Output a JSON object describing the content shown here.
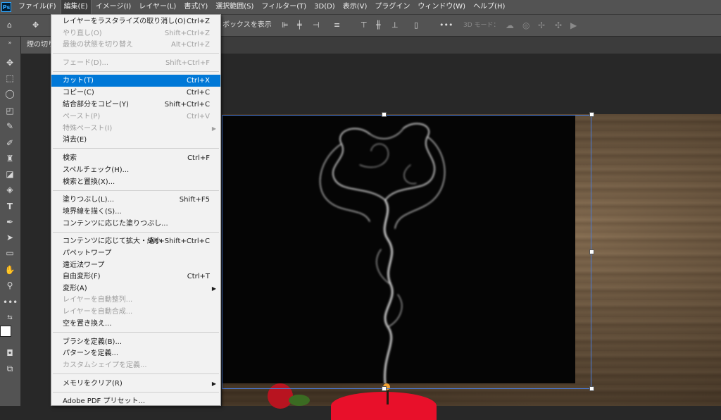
{
  "app": {
    "logo": "Ps"
  },
  "menubar": [
    "ファイル(F)",
    "編集(E)",
    "イメージ(I)",
    "レイヤー(L)",
    "書式(Y)",
    "選択範囲(S)",
    "フィルター(T)",
    "3D(D)",
    "表示(V)",
    "プラグイン",
    "ウィンドウ(W)",
    "ヘルプ(H)"
  ],
  "options": {
    "show_box": "ボックスを表示",
    "mode_3d": "3D モード：",
    "more": "•••"
  },
  "document": {
    "tab_title": "煙の切り"
  },
  "edit_menu": [
    {
      "label": "レイヤーをラスタライズの取り消し(O)",
      "shortcut": "Ctrl+Z",
      "disabled": false
    },
    {
      "label": "やり直し(O)",
      "shortcut": "Shift+Ctrl+Z",
      "disabled": true
    },
    {
      "label": "最後の状態を切り替え",
      "shortcut": "Alt+Ctrl+Z",
      "disabled": true
    },
    {
      "label": "フェード(D)...",
      "shortcut": "Shift+Ctrl+F",
      "disabled": true
    },
    {
      "label": "カット(T)",
      "shortcut": "Ctrl+X",
      "highlight": true
    },
    {
      "label": "コピー(C)",
      "shortcut": "Ctrl+C"
    },
    {
      "label": "結合部分をコピー(Y)",
      "shortcut": "Shift+Ctrl+C"
    },
    {
      "label": "ペースト(P)",
      "shortcut": "Ctrl+V",
      "disabled": true
    },
    {
      "label": "特殊ペースト(I)",
      "shortcut": "",
      "disabled": true,
      "submenu": true
    },
    {
      "label": "消去(E)",
      "shortcut": ""
    },
    {
      "label": "検索",
      "shortcut": "Ctrl+F"
    },
    {
      "label": "スペルチェック(H)...",
      "shortcut": ""
    },
    {
      "label": "検索と置換(X)...",
      "shortcut": ""
    },
    {
      "label": "塗りつぶし(L)...",
      "shortcut": "Shift+F5"
    },
    {
      "label": "境界線を描く(S)...",
      "shortcut": ""
    },
    {
      "label": "コンテンツに応じた塗りつぶし...",
      "shortcut": ""
    },
    {
      "label": "コンテンツに応じて拡大・縮小",
      "shortcut": "Alt+Shift+Ctrl+C"
    },
    {
      "label": "パペットワープ",
      "shortcut": ""
    },
    {
      "label": "遠近法ワープ",
      "shortcut": ""
    },
    {
      "label": "自由変形(F)",
      "shortcut": "Ctrl+T"
    },
    {
      "label": "変形(A)",
      "shortcut": "",
      "submenu": true
    },
    {
      "label": "レイヤーを自動整列...",
      "shortcut": "",
      "disabled": true
    },
    {
      "label": "レイヤーを自動合成...",
      "shortcut": "",
      "disabled": true
    },
    {
      "label": "空を置き換え...",
      "shortcut": ""
    },
    {
      "label": "ブラシを定義(B)...",
      "shortcut": ""
    },
    {
      "label": "パターンを定義...",
      "shortcut": ""
    },
    {
      "label": "カスタムシェイプを定義...",
      "shortcut": "",
      "disabled": true
    },
    {
      "label": "メモリをクリア(R)",
      "shortcut": "",
      "submenu": true
    },
    {
      "label": "Adobe PDF プリセット...",
      "shortcut": ""
    }
  ],
  "colors": {
    "highlight": "#0078d7",
    "panel": "#535353",
    "canvas_bg": "#282828"
  }
}
